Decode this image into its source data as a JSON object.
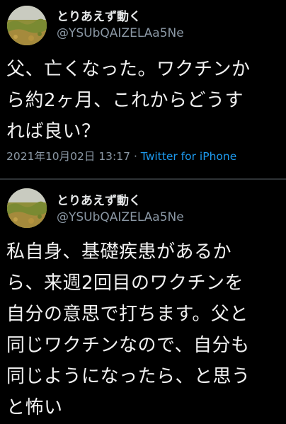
{
  "tweets": [
    {
      "display_name": "とりあえず動く",
      "handle": "@YSUbQAIZELAa5Ne",
      "text_lines": [
        "父、亡くなった。ワクチンか",
        "ら約2ヶ月、これからどうす",
        "れば良い？"
      ],
      "timestamp": "2021年10月02日 13:17",
      "separator": "·",
      "source": "Twitter for iPhone"
    },
    {
      "display_name": "とりあえず動く",
      "handle": "@YSUbQAIZELAa5Ne",
      "text_lines": [
        "私自身、基礎疾患があるか",
        "ら、来週2回目のワクチンを",
        "自分の意思で打ちます。父と",
        "同じワクチンなので、自分も",
        "同じようになったら、と思う",
        "と怖い"
      ]
    }
  ],
  "colors": {
    "background": "#000000",
    "text": "#e7e9ea",
    "secondary": "#8b98a5",
    "link": "#1d9bf0",
    "divider": "#2f3336"
  },
  "icons": {
    "avatar": "grass-field-photo-avatar"
  }
}
